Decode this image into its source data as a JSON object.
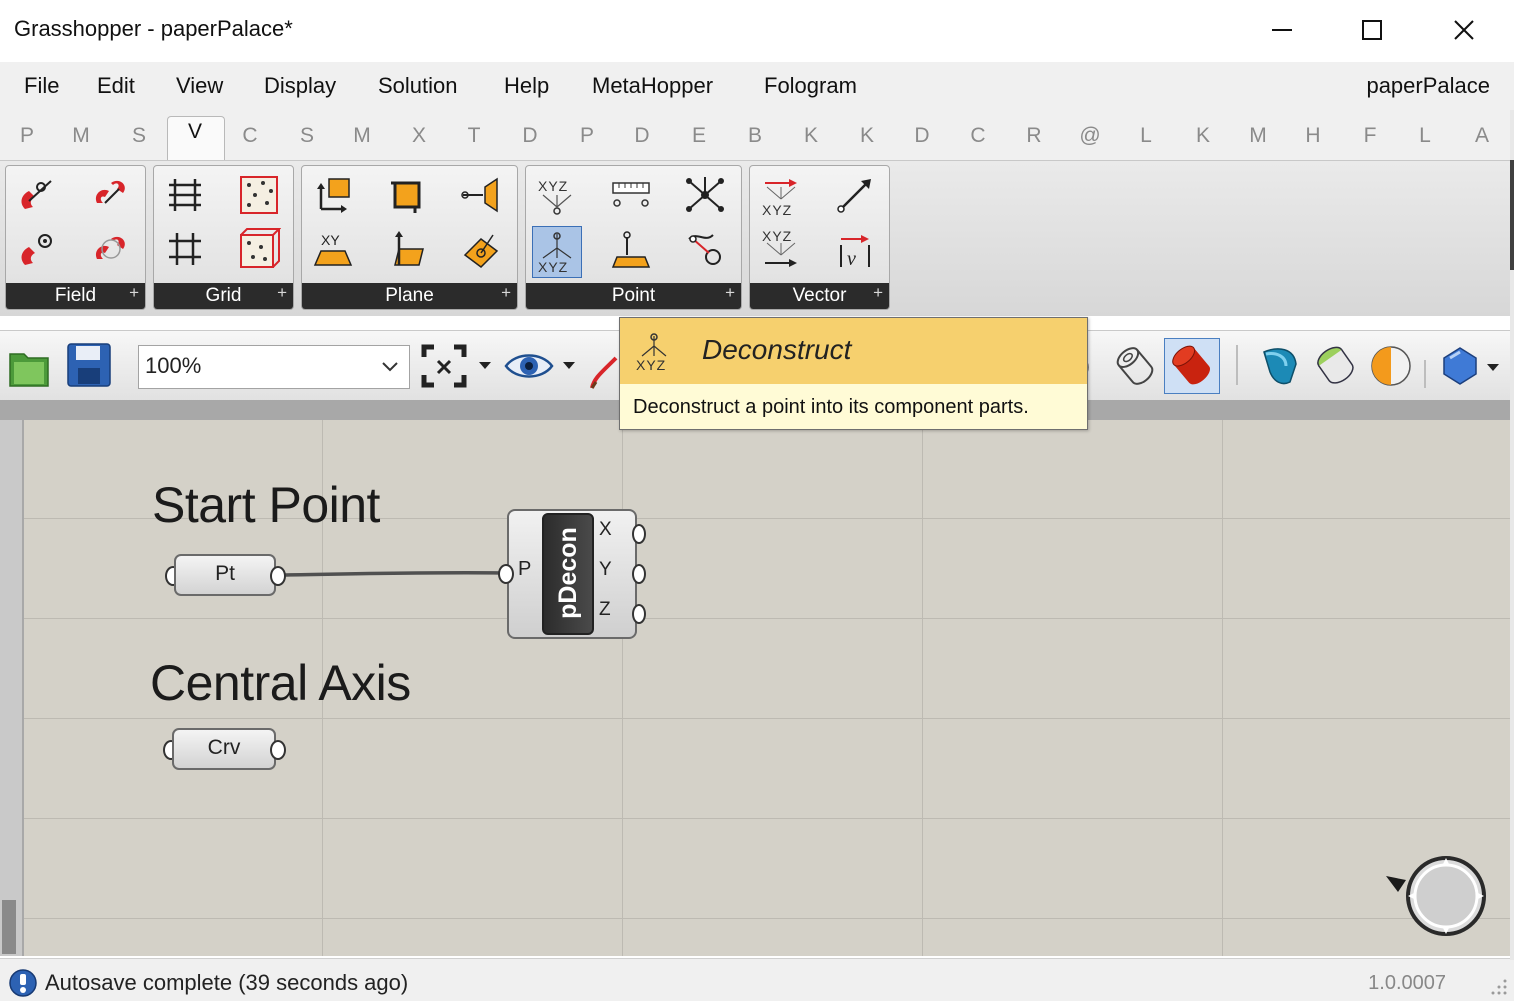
{
  "window": {
    "title": "Grasshopper - paperPalace*",
    "controls": [
      "minimize",
      "maximize",
      "close"
    ]
  },
  "menu": {
    "items": [
      "File",
      "Edit",
      "View",
      "Display",
      "Solution",
      "Help",
      "MetaHopper",
      "Fologram"
    ],
    "document_name": "paperPalace"
  },
  "tabs": {
    "letters": [
      "P",
      "M",
      "S",
      "V",
      "C",
      "S",
      "M",
      "X",
      "T",
      "D",
      "P",
      "D",
      "E",
      "B",
      "K",
      "K",
      "D",
      "C",
      "R",
      "@",
      "L",
      "K",
      "M",
      "H",
      "F",
      "L",
      "A"
    ],
    "active_index": 3
  },
  "ribbon": {
    "groups": [
      {
        "label": "Field",
        "plus": "+"
      },
      {
        "label": "Grid",
        "plus": "+"
      },
      {
        "label": "Plane",
        "plus": "+"
      },
      {
        "label": "Point",
        "plus": "+"
      },
      {
        "label": "Vector",
        "plus": "+"
      }
    ],
    "icon_labels": {
      "xyz": "XYZ",
      "xy": "XY"
    }
  },
  "toolbar": {
    "zoom": "100%"
  },
  "tooltip": {
    "title": "Deconstruct",
    "icon_text": "XYZ",
    "description": "Deconstruct a point into its component parts."
  },
  "canvas": {
    "groups": [
      {
        "title": "Start Point",
        "param_label": "Pt"
      },
      {
        "title": "Central Axis",
        "param_label": "Crv"
      }
    ],
    "component": {
      "name": "pDecon",
      "input": "P",
      "outputs": [
        "X",
        "Y",
        "Z"
      ]
    }
  },
  "status": {
    "message": "Autosave complete (39 seconds ago)",
    "version": "1.0.0007"
  },
  "colors": {
    "canvas": "#d4d1c8",
    "tooltip_header": "#f6d06e",
    "tooltip_body": "#fffbd6",
    "ribbon_label_bg": "#2b2b2b",
    "accent_red": "#d8252a"
  }
}
